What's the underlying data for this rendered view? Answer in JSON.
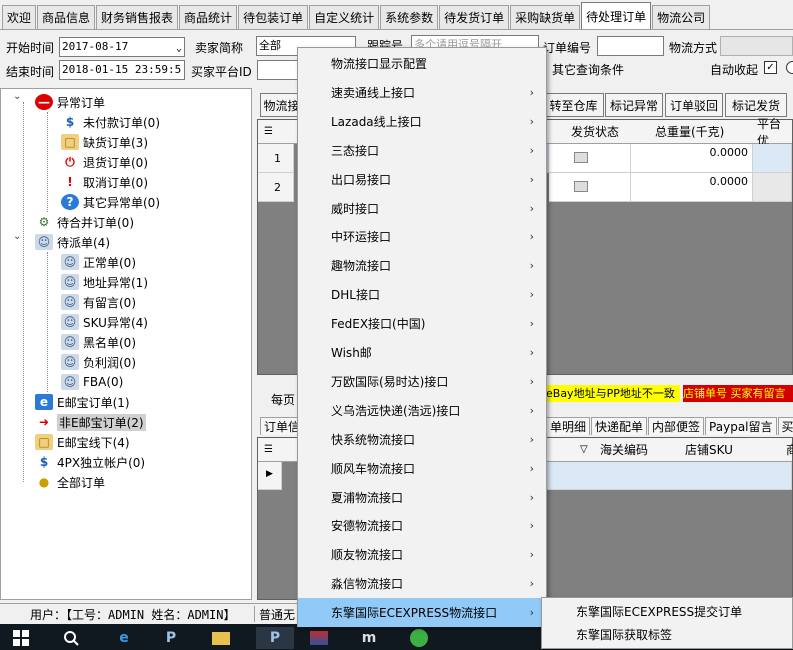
{
  "tabs": [
    "欢迎",
    "商品信息",
    "财务销售报表",
    "商品统计",
    "待包装订单",
    "自定义统计",
    "系统参数",
    "待发货订单",
    "采购缺货单",
    "待处理订单",
    "物流公司"
  ],
  "active_tab": "待处理订单",
  "filters": {
    "start_label": "开始时间",
    "start_value": "2017-08-17",
    "end_label": "结束时间",
    "end_value": "2018-01-15 23:59:5",
    "seller_label": "卖家简称",
    "seller_value": "全部",
    "platform_label": "买家平台ID",
    "tracking_label": "跟踪号",
    "tracking_placeholder": "多个请用逗号隔开",
    "order_label": "订单编号",
    "logistics_label": "物流方式",
    "other_label": "其它查询条件",
    "auto_fold_label": "自动收起"
  },
  "tree": {
    "items": [
      {
        "label": "异常订单",
        "icon": "no-entry-icon"
      },
      {
        "label": "未付款订单(0)",
        "icon": "dollar-icon"
      },
      {
        "label": "缺货订单(3)",
        "icon": "box-icon"
      },
      {
        "label": "退货订单(0)",
        "icon": "power-icon"
      },
      {
        "label": "取消订单(0)",
        "icon": "warning-icon"
      },
      {
        "label": "其它异常单(0)",
        "icon": "question-icon"
      },
      {
        "label": "待合并订单(0)",
        "icon": "gear-icon"
      },
      {
        "label": "待派单(4)",
        "icon": "user-icon"
      },
      {
        "label": "正常单(0)",
        "icon": "user-icon"
      },
      {
        "label": "地址异常(1)",
        "icon": "user-icon"
      },
      {
        "label": "有留言(0)",
        "icon": "user-icon"
      },
      {
        "label": "SKU异常(4)",
        "icon": "user-icon"
      },
      {
        "label": "黑名单(0)",
        "icon": "user-icon"
      },
      {
        "label": "负利润(0)",
        "icon": "user-icon"
      },
      {
        "label": "FBA(0)",
        "icon": "user-icon"
      },
      {
        "label": "E邮宝订单(1)",
        "icon": "e-icon"
      },
      {
        "label": "非E邮宝订单(2)",
        "icon": "arrow-icon"
      },
      {
        "label": "E邮宝线下(4)",
        "icon": "box-icon"
      },
      {
        "label": "4PX独立帐户(0)",
        "icon": "dollar-icon"
      },
      {
        "label": "全部订单",
        "icon": "coins-icon"
      }
    ]
  },
  "right": {
    "buttons": [
      "物流接",
      "转至仓库",
      "标记异常",
      "订单驳回",
      "标记发货"
    ],
    "col_status": "发货状态",
    "col_weight": "总重量(千克)",
    "col_platform": "平台优",
    "rows": [
      {
        "num": "1",
        "weight": "0.0000"
      },
      {
        "num": "2",
        "weight": "0.0000"
      }
    ],
    "per_page": "每页",
    "banner_yellow": "eBay地址与PP地址不一致",
    "banner_red": "店铺单号 买家有留言",
    "bottom_tabs": [
      "订单信",
      "单明细",
      "快递配单",
      "内部便签",
      "Paypal留言",
      "买家"
    ],
    "col_customs": "海关编码",
    "col_sku": "店铺SKU",
    "col_extra": "商"
  },
  "menu": {
    "items": [
      {
        "label": "物流接口显示配置",
        "sub": false
      },
      {
        "label": "速卖通线上接口",
        "sub": true
      },
      {
        "label": "Lazada线上接口",
        "sub": true
      },
      {
        "label": "三态接口",
        "sub": true
      },
      {
        "label": "出口易接口",
        "sub": true
      },
      {
        "label": "威时接口",
        "sub": true
      },
      {
        "label": "中环运接口",
        "sub": true
      },
      {
        "label": "趣物流接口",
        "sub": true
      },
      {
        "label": "DHL接口",
        "sub": true
      },
      {
        "label": "FedEX接口(中国)",
        "sub": true
      },
      {
        "label": "Wish邮",
        "sub": true
      },
      {
        "label": "万欧国际(易时达)接口",
        "sub": true
      },
      {
        "label": "义乌浩远快递(浩远)接口",
        "sub": true
      },
      {
        "label": "快系统物流接口",
        "sub": true
      },
      {
        "label": "顺风车物流接口",
        "sub": true
      },
      {
        "label": "夏浦物流接口",
        "sub": true
      },
      {
        "label": "安德物流接口",
        "sub": true
      },
      {
        "label": "顺友物流接口",
        "sub": true
      },
      {
        "label": "淼信物流接口",
        "sub": true
      },
      {
        "label": "东擎国际ECEXPRESS物流接口",
        "sub": true
      }
    ],
    "highlighted_index": 19
  },
  "submenu": {
    "items": [
      "东擎国际ECEXPRESS提交订单",
      "东擎国际获取标签"
    ]
  },
  "status": {
    "user": "用户：【工号：ADMIN  姓名：ADMIN】",
    "right": "普通无"
  },
  "colors": {
    "menu_highlight": "#91c9f7",
    "banner_yellow": "#ffff00",
    "banner_red_bg": "#d40000",
    "banner_red_text": "#ffff00"
  }
}
